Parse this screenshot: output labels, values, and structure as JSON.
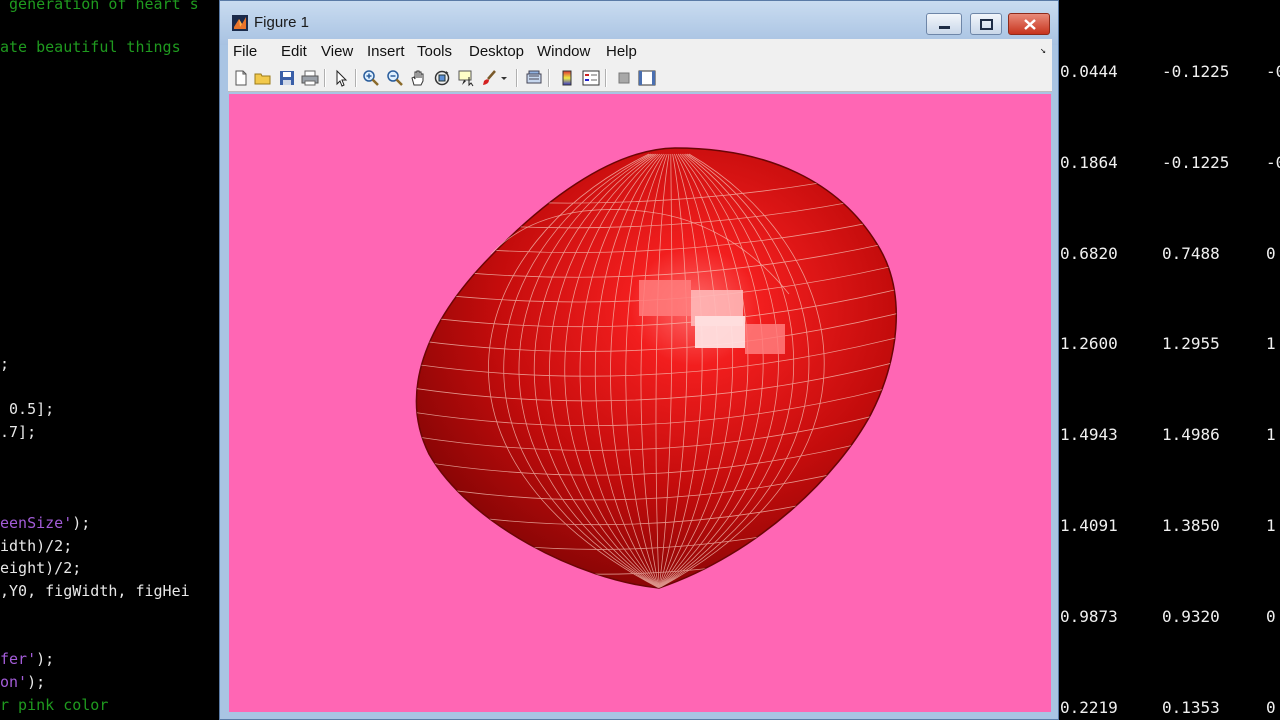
{
  "code_panel": {
    "lines": [
      {
        "text": " generation of heart s",
        "color": "green"
      },
      {
        "text": "ate beautiful things",
        "color": "green"
      },
      {
        "text": ";",
        "color": "white"
      },
      {
        "text": " 0.5];",
        "color": "white"
      },
      {
        "text": ".7];",
        "color": "white"
      },
      {
        "text": "eenSize');",
        "color": "mix",
        "purple": "eenSize'",
        "rest": ");"
      },
      {
        "text": "idth)/2;",
        "color": "white"
      },
      {
        "text": "eight)/2;",
        "color": "white"
      },
      {
        "text": ",Y0, figWidth, figHei",
        "color": "white"
      },
      {
        "text": "fer');",
        "color": "mix",
        "purple": "fer'",
        "rest": ");"
      },
      {
        "text": "on');",
        "color": "mix",
        "purple": "on'",
        "rest": ");"
      },
      {
        "text": "r pink color",
        "color": "green"
      }
    ]
  },
  "output_panel": {
    "rows": [
      [
        "0.0444",
        "-0.1225",
        "-0"
      ],
      [
        "0.1864",
        "-0.1225",
        "-0"
      ],
      [
        "0.6820",
        "0.7488",
        "0"
      ],
      [
        "1.2600",
        "1.2955",
        "1"
      ],
      [
        "1.4943",
        "1.4986",
        "1"
      ],
      [
        "1.4091",
        "1.3850",
        "1"
      ],
      [
        "0.9873",
        "0.9320",
        "0"
      ],
      [
        "0.2219",
        "0.1353",
        "0"
      ]
    ]
  },
  "figure_window": {
    "title": "Figure 1",
    "menus": [
      "File",
      "Edit",
      "View",
      "Insert",
      "Tools",
      "Desktop",
      "Window",
      "Help"
    ],
    "toolbar_icons": [
      "new-figure-icon",
      "open-file-icon",
      "save-icon",
      "print-icon",
      "edit-plot-icon",
      "zoom-in-icon",
      "zoom-out-icon",
      "pan-icon",
      "rotate-3d-icon",
      "data-cursor-icon",
      "brush-icon",
      "link-plot-icon",
      "colorbar-icon",
      "legend-icon",
      "hide-plot-tools-icon",
      "show-plot-tools-icon"
    ],
    "background_color": "#ff66b4",
    "surface_color": "#d81010",
    "mesh_color": "#f6c2b6"
  }
}
